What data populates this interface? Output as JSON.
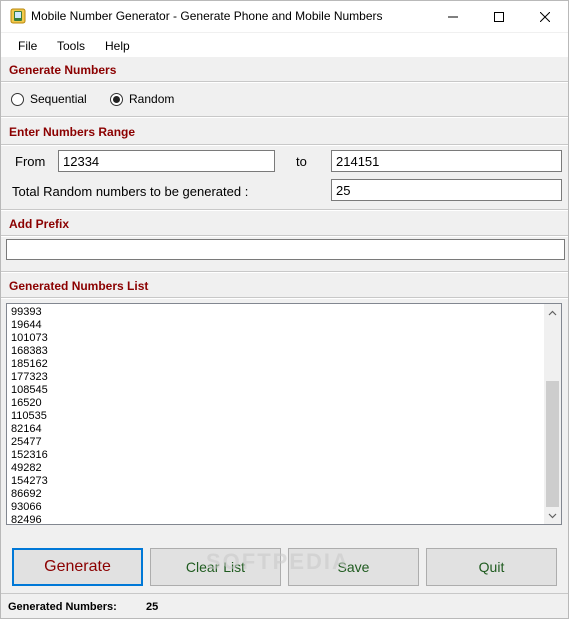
{
  "window": {
    "title": "Mobile Number Generator - Generate Phone and Mobile Numbers",
    "minimize_icon": "minimize-icon",
    "maximize_icon": "maximize-icon",
    "close_icon": "close-icon"
  },
  "menu": {
    "items": [
      {
        "label": "File"
      },
      {
        "label": "Tools"
      },
      {
        "label": "Help"
      }
    ]
  },
  "generate_section": {
    "title": "Generate Numbers",
    "options": [
      {
        "label": "Sequential",
        "checked": false
      },
      {
        "label": "Random",
        "checked": true
      }
    ]
  },
  "range_section": {
    "title": "Enter Numbers Range",
    "from_label": "From",
    "from_value": "12334",
    "to_label": "to",
    "to_value": "214151",
    "count_label": "Total Random numbers to be generated :",
    "count_value": "25"
  },
  "prefix_section": {
    "title": "Add Prefix",
    "prefix_value": ""
  },
  "list_section": {
    "title": "Generated Numbers List",
    "items": [
      "99393",
      "19644",
      "101073",
      "168383",
      "185162",
      "177323",
      "108545",
      "16520",
      "110535",
      "82164",
      "25477",
      "152316",
      "49282",
      "154273",
      "86692",
      "93066",
      "82496"
    ]
  },
  "buttons": {
    "generate": "Generate",
    "clear": "Clear List",
    "save": "Save",
    "quit": "Quit"
  },
  "watermark": "SOFTPEDIA",
  "status": {
    "label": "Generated Numbers:",
    "value": "25"
  },
  "colors": {
    "section_title": "#8b0000",
    "button_text": "#1f5b1f",
    "primary_border": "#0078d7"
  }
}
